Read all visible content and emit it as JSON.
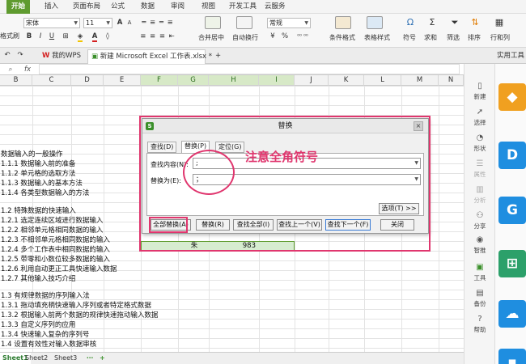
{
  "menubar": {
    "tabs": [
      "开始",
      "插入",
      "页面布局",
      "公式",
      "数据",
      "审阅",
      "视图",
      "开发工具",
      "云服务"
    ],
    "active_index": 0
  },
  "ribbon": {
    "format_painter": "格式刷",
    "font_name": "宋体",
    "font_size": "11",
    "merge_center": "合并居中",
    "wrap_text": "自动换行",
    "number_format": "常规",
    "currency": "¥",
    "percent": "%",
    "cond_format": "条件格式",
    "table_style": "表格样式",
    "symbol": "符号",
    "sum": "求和",
    "filter": "筛选",
    "sort": "排序",
    "rowcol": "行和列"
  },
  "tabbar": {
    "wps_tab": "我的WPS",
    "doc_tab": "新建 Microsoft Excel 工作表.xlsx *",
    "add": "+",
    "right_label": "实用工具"
  },
  "formula": {
    "fx": "fx"
  },
  "columns": [
    "B",
    "C",
    "D",
    "E",
    "F",
    "G",
    "H",
    "I",
    "J",
    "K",
    "L",
    "M",
    "N"
  ],
  "cells": [
    "数据输入的一般操作",
    "1.1.1 数据输入前的准备",
    "1.1.2 单元格的选取方法",
    "1.1.3 数据输入的基本方法",
    "1.1.4 各类型数据输入的方法",
    "1.2 特殊数据的快速输入",
    "1.2.1 选定连续区域进行数据输入",
    "1.2.2 相邻单元格相同数据的输入",
    "1.2.3 不相邻单元格相同数据的输入",
    "1.2.4 多个工作表中相同数据的输入",
    "1.2.5 带零和小数位较多数据的输入",
    "1.2.6 利用自动更正工具快速输入数据",
    "1.2.7 其他输入技巧介绍",
    "1.3 有规律数据的序列输入法",
    "1.3.1 拖动填充柄快速输入序列或者特定格式数据",
    "1.3.2 根据输入前两个数据的规律快速拖动输入数据",
    "1.3.3 自定义序列的应用",
    "1.3.4 快速输入复杂的序列号",
    "1.4 设置有效性对输入数据审核"
  ],
  "highlight_cells": {
    "g": "朱",
    "h": "983"
  },
  "sheets": [
    "Sheet1",
    "Sheet2",
    "Sheet3"
  ],
  "sidepanel": [
    "新建",
    "选择",
    "形状",
    "属性",
    "分析",
    "分享",
    "智推",
    "工具",
    "备份",
    "帮助"
  ],
  "dialog": {
    "title": "替换",
    "tabs": [
      "查找(D)",
      "替换(P)",
      "定位(G)"
    ],
    "find_label": "查找内容(N):",
    "find_value": ";",
    "replace_label": "替换为(E):",
    "replace_value": "；",
    "options_button": "选项(T) >>",
    "buttons": [
      "全部替换(A)",
      "替换(R)",
      "查找全部(I)",
      "查找上一个(V)",
      "查找下一个(F)",
      "关闭"
    ],
    "close_x": "×"
  },
  "annotation": "注意全角符号",
  "colors": {
    "accent_green": "#5f9b2f",
    "annotation_pink": "#e0366e"
  }
}
